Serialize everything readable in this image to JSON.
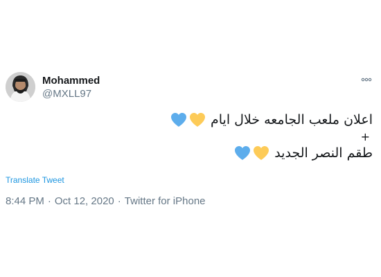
{
  "author": {
    "display_name": "Mohammed",
    "handle": "@MXLL97"
  },
  "tweet": {
    "lines": [
      {
        "text": "اعلان ملعب الجامعه خلال ايام",
        "hearts": [
          "yellow-heart-icon",
          "blue-heart-icon"
        ]
      },
      {
        "text": "+",
        "hearts": []
      },
      {
        "text": "طقم النصر الجديد",
        "hearts": [
          "yellow-heart-icon",
          "blue-heart-icon"
        ]
      }
    ]
  },
  "translate_label": "Translate Tweet",
  "meta": {
    "time": "8:44 PM",
    "separator": "·",
    "date": "Oct 12, 2020",
    "source": "Twitter for iPhone"
  },
  "colors": {
    "yellow_heart": "#fdcb58",
    "blue_heart": "#5dadec",
    "link": "#1b95e0",
    "secondary_text": "#657786"
  }
}
